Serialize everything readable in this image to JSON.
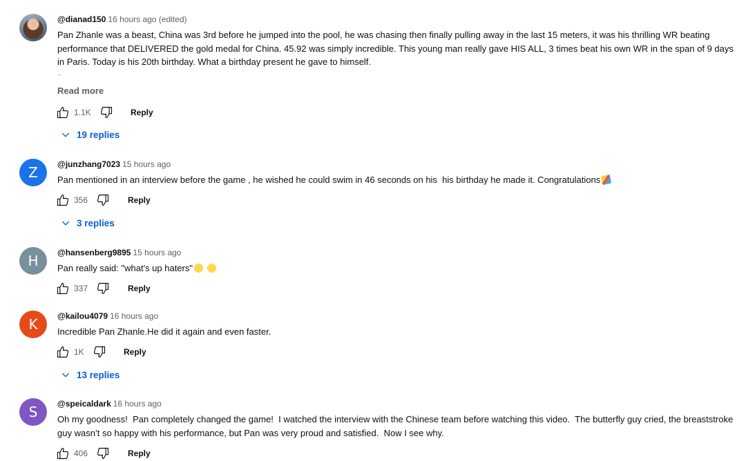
{
  "comments": [
    {
      "avatar": "avatar-photo",
      "handle": "@dianad150",
      "time": "16 hours ago (edited)",
      "text": "Pan Zhanle was a beast, China was 3rd before he jumped into the pool, he was chasing then finally pulling away in the last 15 meters, it was his thrilling WR beating performance that DELIVERED the gold medal for China. 45.92 was simply incredible. This young man really gave HIS ALL, 3 times beat his own WR in the span of 9 days in Paris. Today is his 20th birthday. What a birthday present he gave to himself.",
      "ellipsis": "..",
      "read_more": "Read more",
      "likes": "1.1K",
      "reply_label": "Reply",
      "replies": "19 replies"
    },
    {
      "avatar_letter": "Z",
      "avatar_color": "#1a73e8",
      "handle": "@junzhang7023",
      "time": "15 hours ago",
      "text": "Pan mentioned in an interview before the game , he wished he could swim in 46 seconds on his  his birthday he made it. Congratulations",
      "emoji": "party-popper",
      "likes": "356",
      "reply_label": "Reply",
      "replies": "3 replies"
    },
    {
      "avatar_letter": "H",
      "avatar_color": "#78909c",
      "handle": "@hansenberg9895",
      "time": "15 hours ago",
      "text": "Pan really said: \"what's up haters\"",
      "emoji": "rofl, joy",
      "likes": "337",
      "reply_label": "Reply"
    },
    {
      "avatar_letter": "K",
      "avatar_color": "#e64a19",
      "handle": "@kailou4079",
      "time": "16 hours ago",
      "text": "Incredible Pan Zhanle.He did it again and even faster.",
      "likes": "1K",
      "reply_label": "Reply",
      "replies": "13 replies"
    },
    {
      "avatar_letter": "S",
      "avatar_color": "#7e57c2",
      "handle": "@speicaldark",
      "time": "16 hours ago",
      "text": "Oh my goodness!  Pan completely changed the game!  I watched the interview with the Chinese team before watching this video.  The butterfly guy cried, the breaststroke guy wasn’t so happy with his performance, but Pan was very proud and satisfied.  Now I see why.",
      "likes": "406",
      "reply_label": "Reply"
    }
  ],
  "icons": {
    "like": "thumbs-up-icon",
    "dislike": "thumbs-down-icon",
    "expand": "chevron-down-icon"
  },
  "colors": {
    "link_blue": "#065fd4",
    "secondary_text": "#606060"
  }
}
